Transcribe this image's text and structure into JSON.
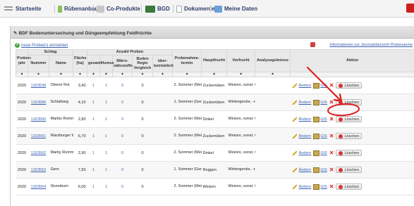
{
  "nav": {
    "items": [
      {
        "label": "Startseite",
        "icon": "dashes-icon"
      },
      {
        "label": "Rübenanbau",
        "icon": "plant-icon"
      },
      {
        "label": "Co-Produkte",
        "icon": "box-icon"
      },
      {
        "label": "BGD",
        "icon": "grid-icon"
      },
      {
        "label": "Dokumente",
        "icon": "document-icon"
      },
      {
        "label": "Meine Daten",
        "icon": "table-icon"
      }
    ]
  },
  "panel": {
    "title": "BDF Bodenuntersuchung und Düngeempfehlung Feldfrüchte",
    "new_link": "neue Probe(n) anmelden",
    "info_link": "Informationen zur Journalübersicht Probenanme"
  },
  "table": {
    "group_headers": {
      "schlag": "Schlag",
      "anzahl": "Anzahl Proben"
    },
    "headers": {
      "jahr": "Proben-jahr",
      "nummer": "Nummer",
      "name": "Name",
      "flaeche": "Fläche [ha]",
      "gesamt": "gesamt",
      "humus": "Humus",
      "mikro": "Mikro-nährstoffe",
      "boden": "Boden Regio Vergleich",
      "ueber": "über-betrieblich",
      "termin": "Probenahme-termin",
      "haupt": "Hauptfrucht",
      "vor": "Vorfrucht",
      "analyse": "Analysegebnisse",
      "aktion": "Aktion"
    },
    "sort_marker": "▲",
    "rows": [
      {
        "jahr": "2020",
        "nummer": "1323538",
        "name": "Oberer Rot",
        "flaeche": "3,40",
        "gesamt": "1",
        "humus": "1",
        "mikro": "0",
        "boden": "0",
        "termin": "2. Sommer (Weizen)",
        "haupt": "Zuckerrüben",
        "vor": "Weizen, sonst. Getreide"
      },
      {
        "jahr": "2020",
        "nummer": "1323585",
        "name": "Schlafweg",
        "flaeche": "4,10",
        "gesamt": "1",
        "humus": "1",
        "mikro": "0",
        "boden": "0",
        "termin": "1. Sommer (Gerste)",
        "haupt": "Zuckerrüben",
        "vor": "Wintergerste, -roggen"
      },
      {
        "jahr": "2020",
        "nummer": "1323560",
        "name": "Marbis Rommert",
        "flaeche": "2,80",
        "gesamt": "1",
        "humus": "1",
        "mikro": "0",
        "boden": "0",
        "termin": "2. Sommer (Weizen)",
        "haupt": "Dinkel",
        "vor": "Weizen, sonst. Getreide"
      },
      {
        "jahr": "2020",
        "nummer": "1323561",
        "name": "Warzburger Weg",
        "flaeche": "6,70",
        "gesamt": "1",
        "humus": "1",
        "mikro": "0",
        "boden": "0",
        "termin": "2. Sommer (Weizen)",
        "haupt": "Zuckerrüben",
        "vor": "Weizen, sonst. Getreide"
      },
      {
        "jahr": "2020",
        "nummer": "1323562",
        "name": "Marby Rommert",
        "flaeche": "2,90",
        "gesamt": "1",
        "humus": "1",
        "mikro": "0",
        "boden": "0",
        "termin": "2. Sommer (Weizen)",
        "haupt": "Dinkel",
        "vor": "Weizen, sonst. Getreide"
      },
      {
        "jahr": "2020",
        "nummer": "1323563",
        "name": "Gern",
        "flaeche": "7,50",
        "gesamt": "1",
        "humus": "1",
        "mikro": "0",
        "boden": "0",
        "termin": "1. Sommer (Gerste)",
        "haupt": "Roggen",
        "vor": "Wintergerste, -roggen"
      },
      {
        "jahr": "2020",
        "nummer": "1323564",
        "name": "Storrsbum",
        "flaeche": "6,00",
        "gesamt": "1",
        "humus": "1",
        "mikro": "0",
        "boden": "0",
        "termin": "2. Sommer (Weizen)",
        "haupt": "Weizen",
        "vor": "Weizen, sonst. Getreide"
      }
    ],
    "actions": {
      "edit": "Ändern",
      "gis": "GIS",
      "delete": "Löschen"
    }
  },
  "colors": {
    "link": "#3a5fb0",
    "annotation": "#e0201e"
  }
}
